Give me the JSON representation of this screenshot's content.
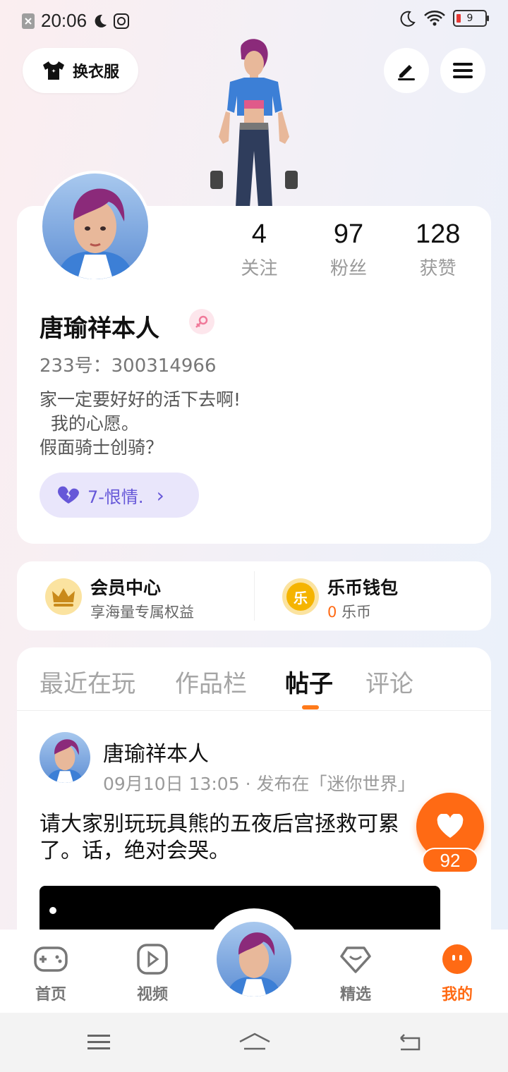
{
  "status_bar": {
    "time": "20:06",
    "battery": "9"
  },
  "header": {
    "outfit_label": "换衣服"
  },
  "profile": {
    "stats": [
      {
        "num": "4",
        "label": "关注"
      },
      {
        "num": "97",
        "label": "粉丝"
      },
      {
        "num": "128",
        "label": "获赞"
      }
    ],
    "name": "唐瑜祥本人",
    "id_text": "233号：300314966",
    "bio": "家一定要好好的活下去啊!\n  我的心愿。\n假面骑士创骑？",
    "mood": "7-恨情.",
    "mood_chevron": "›"
  },
  "member": {
    "title": "会员中心",
    "subtitle": "享海量专属权益"
  },
  "wallet": {
    "title": "乐币钱包",
    "amount": "0",
    "unit": "乐币",
    "coin_char": "乐"
  },
  "tabs": [
    "最近在玩",
    "作品栏",
    "帖子",
    "评论"
  ],
  "post": {
    "author": "唐瑜祥本人",
    "meta": "09月10日 13:05 · 发布在「迷你世界」",
    "text": "请大家别玩玩具熊的五夜后宫拯救可累了。话，绝对会哭。"
  },
  "like": {
    "count": "92"
  },
  "bottom_nav": [
    {
      "label": "首页"
    },
    {
      "label": "视频"
    },
    {
      "label": "精选"
    },
    {
      "label": "我的"
    }
  ],
  "colors": {
    "accent": "#ff6a14",
    "mood": "#6657d8",
    "gold": "#f5b400"
  }
}
